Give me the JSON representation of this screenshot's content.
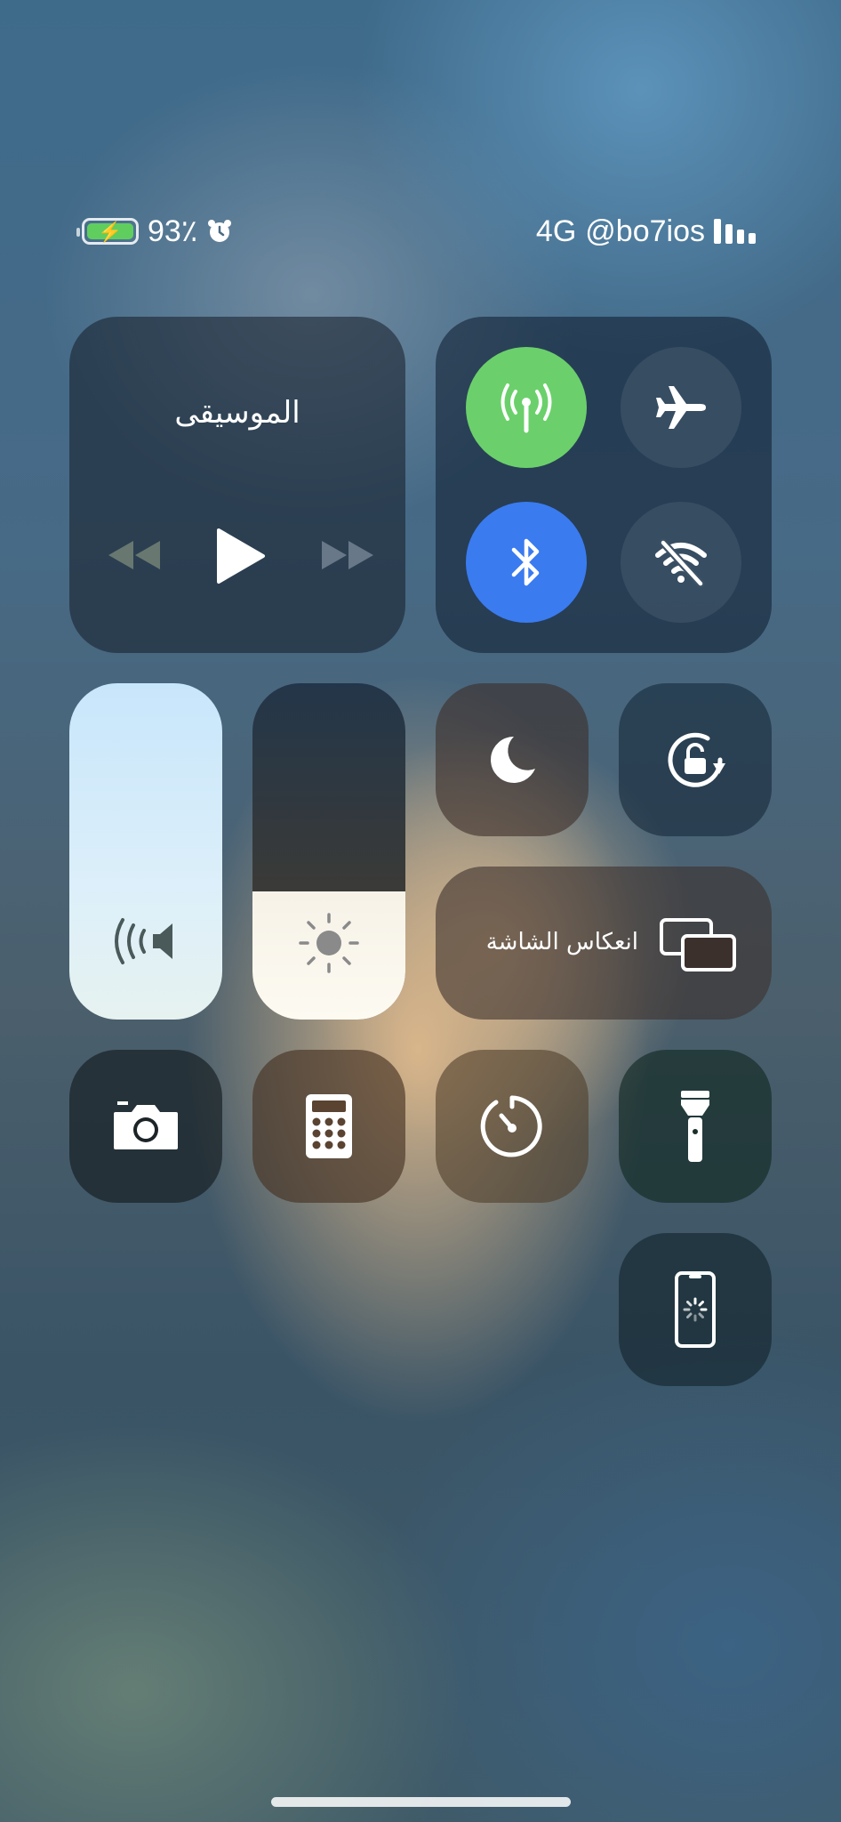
{
  "status_bar": {
    "battery_percent": "93٪",
    "battery_level": 0.93,
    "network_type": "4G",
    "carrier": "@bo7ios",
    "battery_color": "#5fce5f"
  },
  "music": {
    "title": "الموسيقى",
    "icons": [
      "backward-icon",
      "play-icon",
      "forward-icon"
    ]
  },
  "connectivity": {
    "cellular_on": true,
    "airplane_on": false,
    "bluetooth_on": true,
    "wifi_on": false,
    "cellular_color": "#6bd06b",
    "bluetooth_color": "#3a7bf0"
  },
  "sliders": {
    "volume_level": 1.0,
    "brightness_level": 0.38
  },
  "screen_mirroring": {
    "label": "انعكاس الشاشة"
  },
  "toggles": {
    "do_not_disturb": "moon-icon",
    "orientation_lock": "rotation-lock-icon",
    "camera": "camera-icon",
    "calculator": "calculator-icon",
    "timer": "timer-icon",
    "flashlight": "flashlight-icon",
    "screen_recording": "screen-recording-icon"
  }
}
